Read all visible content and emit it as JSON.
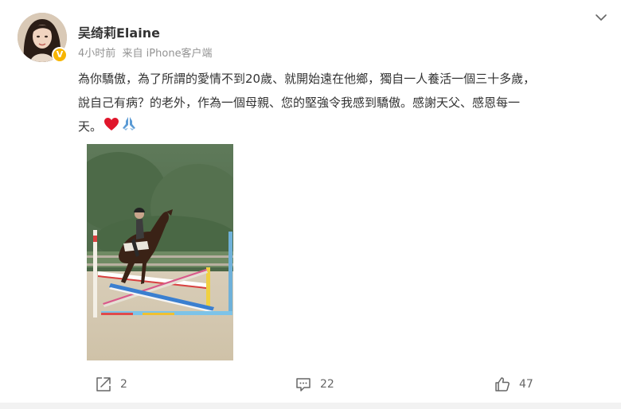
{
  "post": {
    "username": "吴绮莉Elaine",
    "time": "4小时前",
    "source": "来自 iPhone客户端",
    "text_lines": [
      "為你驕傲，為了所謂的愛情不到20歲、就開始遠在他鄉，獨自一人養活一個三十多歲，",
      "說自己有病？的老外，作為一個母親、您的堅強令我感到驕傲。感謝天父、感恩每一",
      "天。"
    ],
    "emojis": [
      "heart-icon",
      "praying-hands-icon"
    ],
    "verified_badge": "V"
  },
  "actions": {
    "share_count": "2",
    "comment_count": "22",
    "like_count": "47"
  },
  "colors": {
    "text": "#333333",
    "meta": "#939393",
    "verified": "#f7b500",
    "heart": "#e0162b"
  }
}
